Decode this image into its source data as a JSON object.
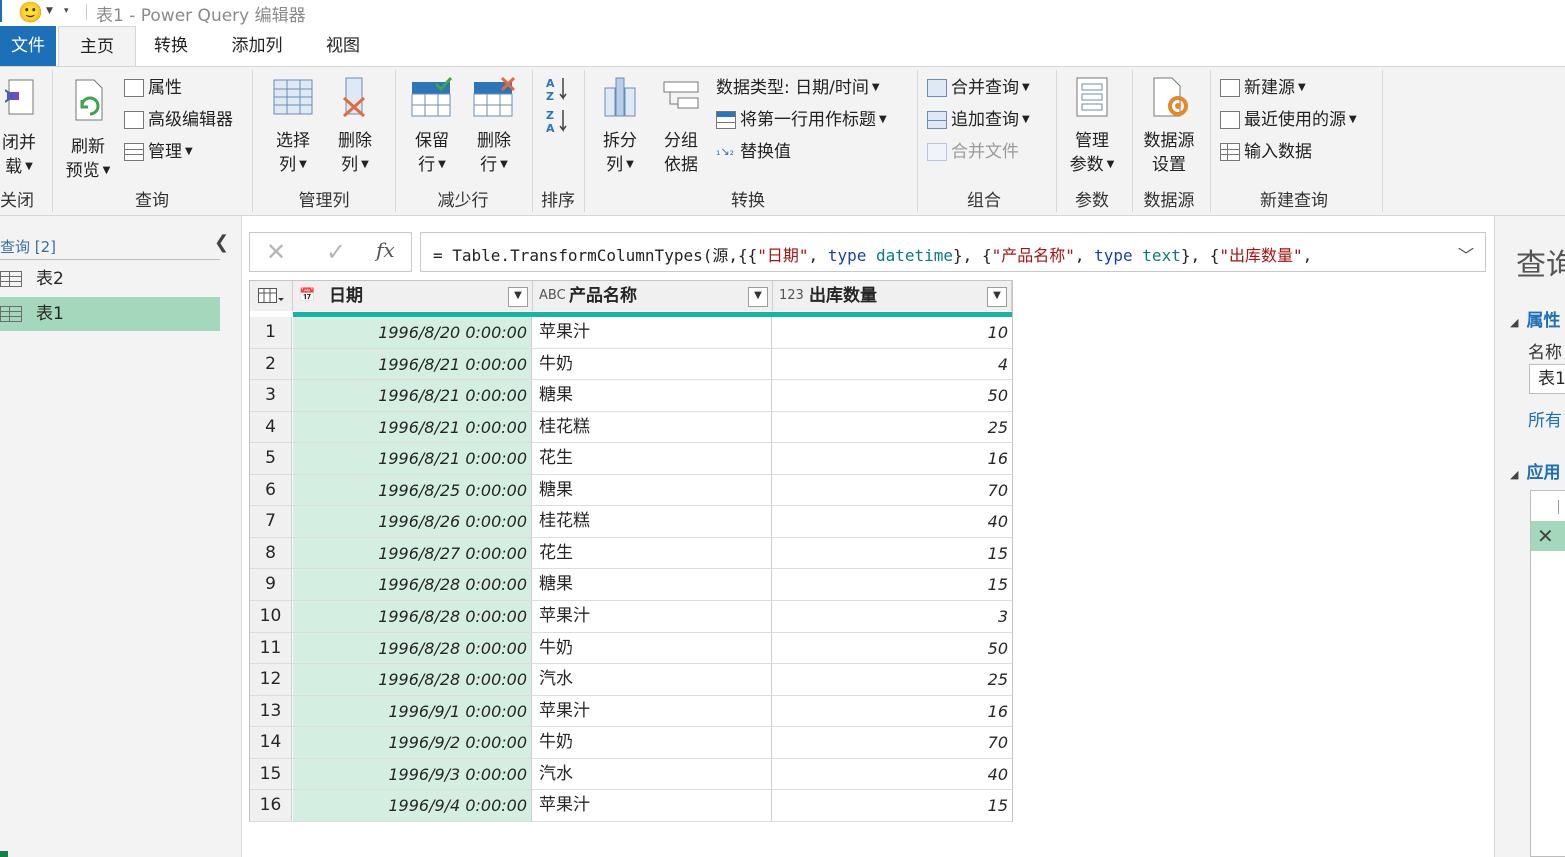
{
  "title_bar": {
    "emoji": "🙂",
    "title": "表1 - Power Query 编辑器"
  },
  "tabs": [
    {
      "label": "文件"
    },
    {
      "label": "主页"
    },
    {
      "label": "转换"
    },
    {
      "label": "添加列"
    },
    {
      "label": "视图"
    }
  ],
  "ribbon": {
    "close": {
      "btn_line1": "闭并",
      "btn_line2": "载",
      "group": "关闭"
    },
    "query": {
      "refresh_line1": "刷新",
      "refresh_line2": "预览",
      "properties": "属性",
      "advanced_editor": "高级编辑器",
      "manage": "管理",
      "group": "查询"
    },
    "manage_cols": {
      "choose_line1": "选择",
      "choose_line2": "列",
      "remove_line1": "删除",
      "remove_line2": "列",
      "group": "管理列"
    },
    "reduce_rows": {
      "keep_line1": "保留",
      "keep_line2": "行",
      "remove_line1": "删除",
      "remove_line2": "行",
      "group": "减少行"
    },
    "sort": {
      "group": "排序"
    },
    "transform": {
      "split_line1": "拆分",
      "split_line2": "列",
      "groupby_line1": "分组",
      "groupby_line2": "依据",
      "datatype": "数据类型: 日期/时间",
      "first_row_header": "将第一行用作标题",
      "replace_values": "替换值",
      "group": "转换"
    },
    "combine": {
      "merge_queries": "合并查询",
      "append_queries": "追加查询",
      "combine_files": "合并文件",
      "group": "组合"
    },
    "params": {
      "manage_line1": "管理",
      "manage_line2": "参数",
      "group": "参数"
    },
    "datasource": {
      "settings_line1": "数据源",
      "settings_line2": "设置",
      "group": "数据源"
    },
    "new_query": {
      "new_source": "新建源",
      "recent_sources": "最近使用的源",
      "enter_data": "输入数据",
      "group": "新建查询"
    }
  },
  "left_pane": {
    "header": "查询 [2]",
    "items": [
      {
        "label": "表2"
      },
      {
        "label": "表1"
      }
    ]
  },
  "formula_bar": {
    "cancel": "✕",
    "commit": "✓",
    "fx": "fx",
    "p1": "= Table.TransformColumnTypes(源,{{",
    "s1": "\"日期\"",
    "p2": ", ",
    "k1": "type",
    "p3": " ",
    "t1": "datetime",
    "p4": "}, {",
    "s2": "\"产品名称\"",
    "p5": ", ",
    "k2": "type",
    "p6": " ",
    "t2": "text",
    "p7": "}, {",
    "s3": "\"出库数量\"",
    "p8": ","
  },
  "grid": {
    "columns": [
      {
        "type_icon": "📅",
        "name": "日期"
      },
      {
        "type_icon": "ABC",
        "name": "产品名称"
      },
      {
        "type_icon": "123",
        "name": "出库数量"
      }
    ],
    "rows": [
      {
        "n": "1",
        "date": "1996/8/20 0:00:00",
        "product": "苹果汁",
        "qty": "10"
      },
      {
        "n": "2",
        "date": "1996/8/21 0:00:00",
        "product": "牛奶",
        "qty": "4"
      },
      {
        "n": "3",
        "date": "1996/8/21 0:00:00",
        "product": "糖果",
        "qty": "50"
      },
      {
        "n": "4",
        "date": "1996/8/21 0:00:00",
        "product": "桂花糕",
        "qty": "25"
      },
      {
        "n": "5",
        "date": "1996/8/21 0:00:00",
        "product": "花生",
        "qty": "16"
      },
      {
        "n": "6",
        "date": "1996/8/25 0:00:00",
        "product": "糖果",
        "qty": "70"
      },
      {
        "n": "7",
        "date": "1996/8/26 0:00:00",
        "product": "桂花糕",
        "qty": "40"
      },
      {
        "n": "8",
        "date": "1996/8/27 0:00:00",
        "product": "花生",
        "qty": "15"
      },
      {
        "n": "9",
        "date": "1996/8/28 0:00:00",
        "product": "糖果",
        "qty": "15"
      },
      {
        "n": "10",
        "date": "1996/8/28 0:00:00",
        "product": "苹果汁",
        "qty": "3"
      },
      {
        "n": "11",
        "date": "1996/8/28 0:00:00",
        "product": "牛奶",
        "qty": "50"
      },
      {
        "n": "12",
        "date": "1996/8/28 0:00:00",
        "product": "汽水",
        "qty": "25"
      },
      {
        "n": "13",
        "date": "1996/9/1 0:00:00",
        "product": "苹果汁",
        "qty": "16"
      },
      {
        "n": "14",
        "date": "1996/9/2 0:00:00",
        "product": "牛奶",
        "qty": "70"
      },
      {
        "n": "15",
        "date": "1996/9/3 0:00:00",
        "product": "汽水",
        "qty": "40"
      },
      {
        "n": "16",
        "date": "1996/9/4 0:00:00",
        "product": "苹果汁",
        "qty": "15"
      }
    ]
  },
  "right_pane": {
    "title": "查询",
    "properties": "属性",
    "name_label": "名称",
    "name_value": "表1",
    "all_props": "所有",
    "applied_steps": "应用",
    "selected_step_icon": "✕"
  }
}
